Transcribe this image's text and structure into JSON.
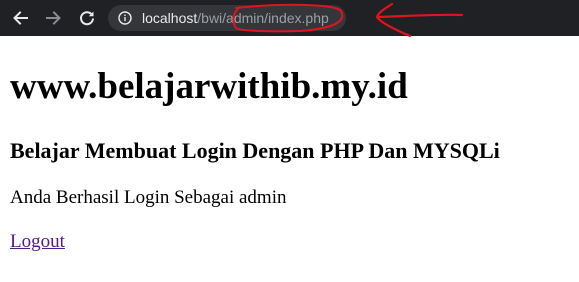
{
  "browser": {
    "url_host": "localhost",
    "url_path": "/bwi/admin/index.php",
    "icons": {
      "back": "back-arrow-icon",
      "forward": "forward-arrow-icon",
      "reload": "reload-icon",
      "info": "info-icon"
    },
    "colors": {
      "toolbar_bg": "#202124",
      "omnibox_bg": "#35363a",
      "annotation": "#e0141e"
    }
  },
  "page": {
    "site_title": "www.belajarwithib.my.id",
    "subtitle": "Belajar Membuat Login Dengan PHP Dan MYSQLi",
    "status_message": "Anda Berhasil Login Sebagai admin",
    "logout_label": "Logout"
  }
}
